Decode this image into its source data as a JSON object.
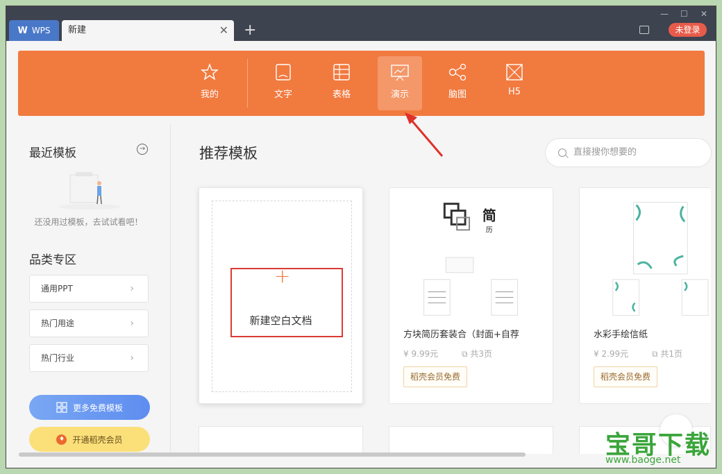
{
  "titlebar": {
    "wps_tab_label": "WPS",
    "new_tab_label": "新建",
    "login_label": "未登录"
  },
  "categories": [
    {
      "label": "我的",
      "icon": "star-icon"
    },
    {
      "label": "文字",
      "icon": "document-icon"
    },
    {
      "label": "表格",
      "icon": "table-icon"
    },
    {
      "label": "演示",
      "icon": "presentation-icon",
      "active": true
    },
    {
      "label": "脑图",
      "icon": "mindmap-icon"
    },
    {
      "label": "H5",
      "icon": "h5-icon"
    }
  ],
  "sidebar": {
    "recent_title": "最近模板",
    "recent_empty_text": "还没用过模板，去试试看吧！",
    "category_title": "品类专区",
    "category_items": [
      "通用PPT",
      "热门用途",
      "热门行业"
    ],
    "more_free_label": "更多免费模板",
    "vip_label": "开通稻壳会员"
  },
  "main": {
    "title": "推荐模板",
    "search_placeholder": "直接搜你想要的",
    "blank_doc_label": "新建空白文档",
    "cards": [
      {
        "title": "方块简历套装合（封面+自荐",
        "price": "9.99元",
        "pages": "共3页",
        "badge": "稻壳会员免费",
        "thumb_text_1": "简",
        "thumb_text_2": "历"
      },
      {
        "title": "水彩手绘信纸",
        "price": "2.99元",
        "pages": "共1页",
        "badge": "稻壳会员免费"
      }
    ]
  },
  "watermark": {
    "text": "宝哥下载",
    "url": "www.baoge.net"
  },
  "colors": {
    "accent": "#f17a3f",
    "highlight": "#d93a33",
    "titlebar": "#3e4350"
  }
}
